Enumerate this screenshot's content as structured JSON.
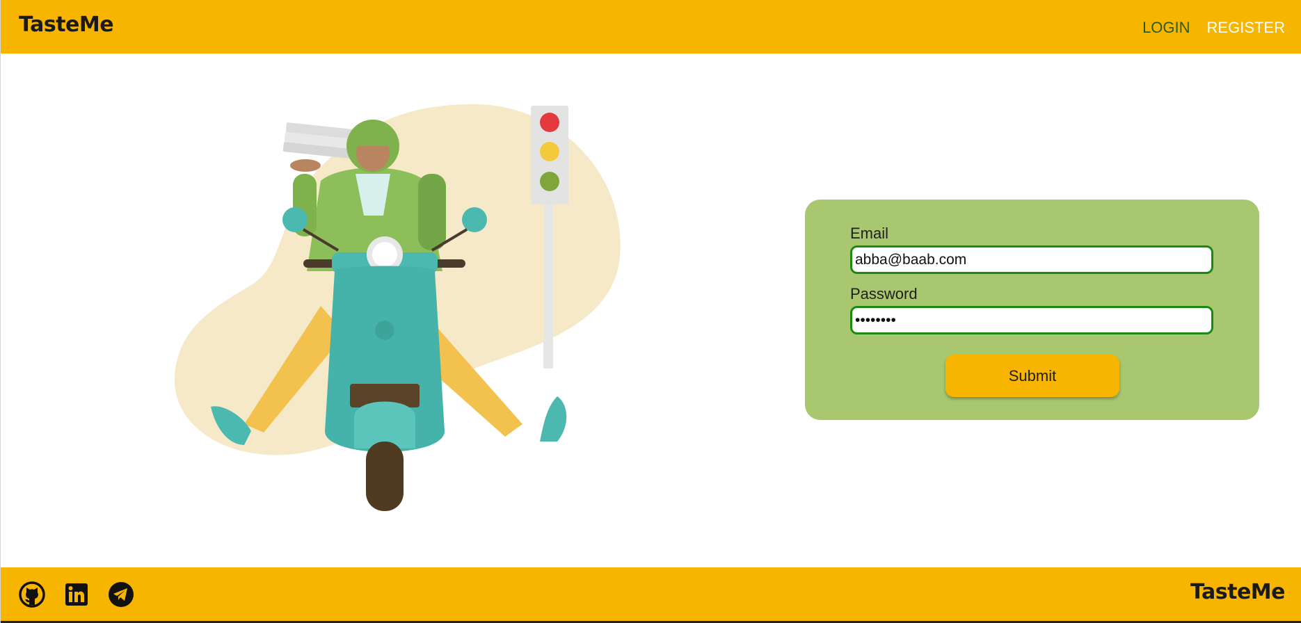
{
  "header": {
    "brand": "TasteMe",
    "nav": {
      "login_label": "LOGIN",
      "register_label": "REGISTER"
    }
  },
  "illustration": {
    "subject": "delivery-rider-scooter-illustration"
  },
  "login_form": {
    "email_label": "Email",
    "email_value": "abba@baab.com",
    "password_label": "Password",
    "password_value": "••••••••",
    "submit_label": "Submit"
  },
  "footer": {
    "brand": "TasteMe",
    "social_icons": [
      "github-icon",
      "linkedin-icon",
      "telegram-icon"
    ]
  },
  "colors": {
    "header_bg": "#f7b500",
    "form_bg": "#a9c76e",
    "input_border": "#1b8a12",
    "login_link": "#2d5a1a",
    "register_link": "#ffffff",
    "button_bg": "#f7b500"
  }
}
